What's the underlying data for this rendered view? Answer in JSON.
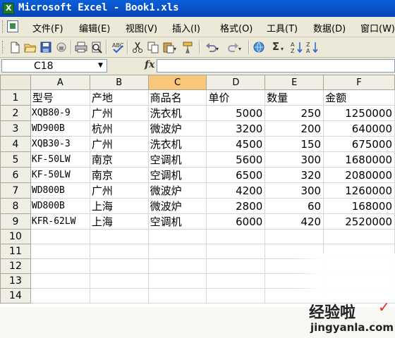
{
  "window": {
    "title": "Microsoft Excel - Book1.xls"
  },
  "menu": {
    "items": [
      "文件(F)",
      "编辑(E)",
      "视图(V)",
      "插入(I)",
      "格式(O)",
      "工具(T)",
      "数据(D)",
      "窗口(W)"
    ]
  },
  "toolbar": {
    "icons": [
      "new-icon",
      "open-icon",
      "save-icon",
      "permission-icon",
      "print-icon",
      "print-preview-icon",
      "spelling-icon",
      "cut-icon",
      "copy-icon",
      "paste-icon",
      "format-painter-icon",
      "undo-icon",
      "redo-icon",
      "hyperlink-icon",
      "autosum-icon",
      "sort-ascending-icon",
      "sort-descending-icon"
    ],
    "autosum_glyph": "Σ"
  },
  "formula_bar": {
    "name_box": "C18",
    "fx_label": "fx",
    "content": ""
  },
  "sheet": {
    "columns": [
      "A",
      "B",
      "C",
      "D",
      "E",
      "F"
    ],
    "active_column": "C",
    "rows": [
      "1",
      "2",
      "3",
      "4",
      "5",
      "6",
      "7",
      "8",
      "9",
      "10",
      "11",
      "12",
      "13",
      "14"
    ],
    "headers": [
      "型号",
      "产地",
      "商品名",
      "单价",
      "数量",
      "金额"
    ],
    "data": [
      [
        "XQB80-9",
        "广州",
        "洗衣机",
        "5000",
        "250",
        "1250000"
      ],
      [
        "WD900B",
        "杭州",
        "微波炉",
        "3200",
        "200",
        "640000"
      ],
      [
        "XQB30-3",
        "广州",
        "洗衣机",
        "4500",
        "150",
        "675000"
      ],
      [
        "KF-50LW",
        "南京",
        "空调机",
        "5600",
        "300",
        "1680000"
      ],
      [
        "KF-50LW",
        "南京",
        "空调机",
        "6500",
        "320",
        "2080000"
      ],
      [
        "WD800B",
        "广州",
        "微波炉",
        "4200",
        "300",
        "1260000"
      ],
      [
        "WD800B",
        "上海",
        "微波炉",
        "2800",
        "60",
        "168000"
      ],
      [
        "KFR-62LW",
        "上海",
        "空调机",
        "6000",
        "420",
        "2520000"
      ]
    ]
  },
  "watermark": {
    "text": "经验啦",
    "check": "✓",
    "url": "jingyanla.com"
  },
  "colors": {
    "titlebar": "#0a5fd8",
    "chrome": "#ece9d8",
    "active_header": "#f9c77b",
    "gridline": "#d0d7e5"
  }
}
